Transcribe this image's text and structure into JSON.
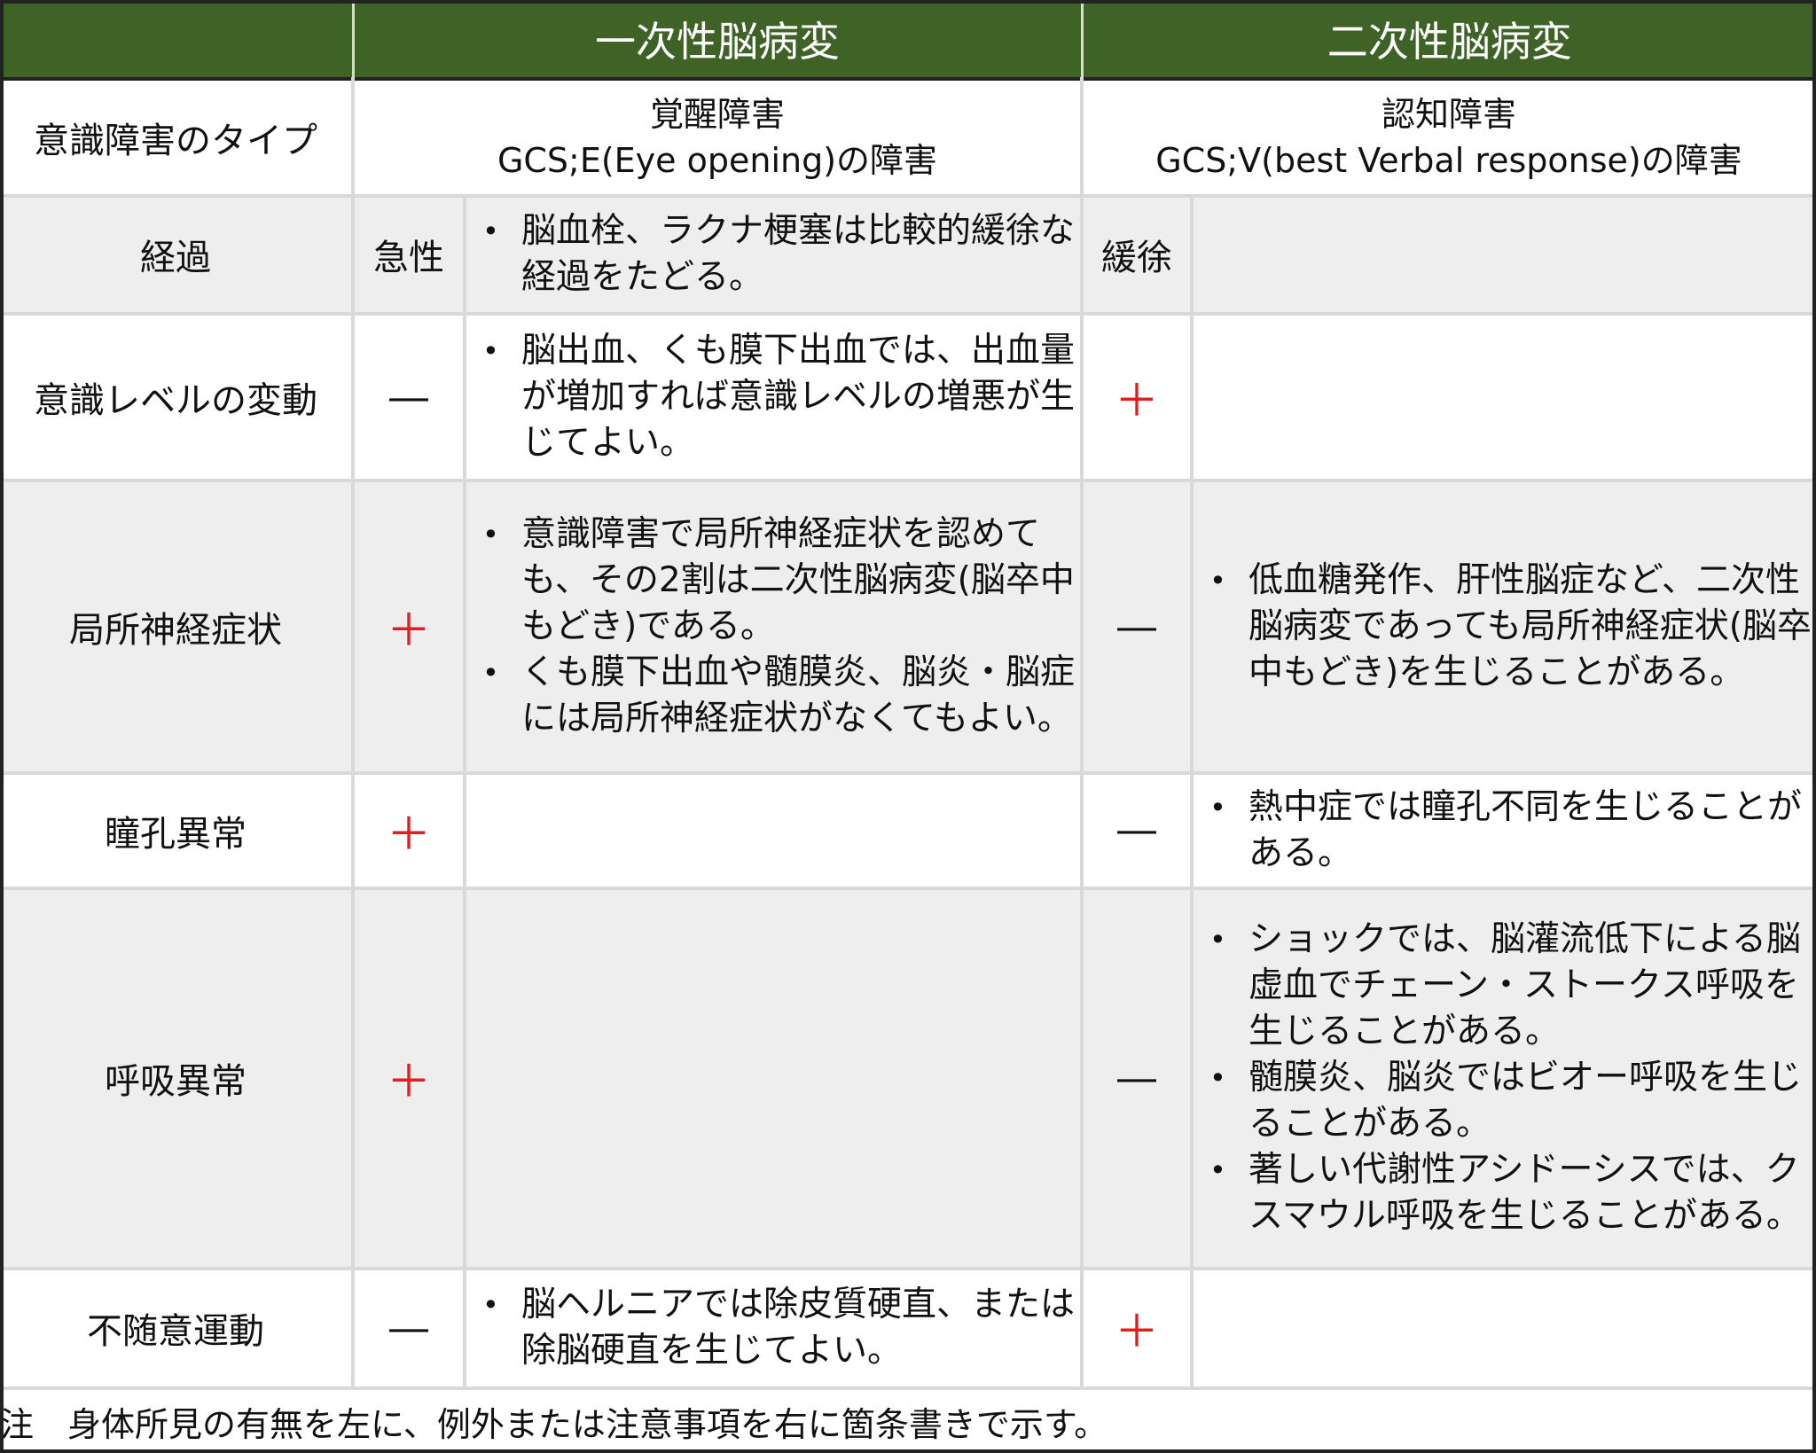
{
  "header": {
    "primary": "一次性脳病変",
    "secondary": "二次性脳病変"
  },
  "rows": {
    "type": {
      "label": "意識障害のタイプ",
      "primary_line1": "覚醒障害",
      "primary_line2": "GCS;E(Eye opening)の障害",
      "secondary_line1": "認知障害",
      "secondary_line2": "GCS;V(best Verbal response)の障害"
    },
    "course": {
      "label": "経過",
      "primary_sign": "急性",
      "primary_notes": [
        "脳血栓、ラクナ梗塞は比較的緩徐な経過をたどる。"
      ],
      "secondary_sign": "緩徐",
      "secondary_notes": []
    },
    "fluctuation": {
      "label": "意識レベルの変動",
      "primary_sign": "―",
      "primary_notes": [
        "脳出血、くも膜下出血では、出血量が増加すれば意識レベルの増悪が生じてよい。"
      ],
      "secondary_sign": "＋",
      "secondary_notes": []
    },
    "focal": {
      "label": "局所神経症状",
      "primary_sign": "＋",
      "primary_notes": [
        "意識障害で局所神経症状を認めても、その2割は二次性脳病変(脳卒中もどき)である。",
        "くも膜下出血や髄膜炎、脳炎・脳症には局所神経症状がなくてもよい。"
      ],
      "secondary_sign": "―",
      "secondary_notes": [
        "低血糖発作、肝性脳症など、二次性脳病変であっても局所神経症状(脳卒中もどき)を生じることがある。"
      ]
    },
    "pupil": {
      "label": "瞳孔異常",
      "primary_sign": "＋",
      "primary_notes": [],
      "secondary_sign": "―",
      "secondary_notes": [
        "熱中症では瞳孔不同を生じることがある。"
      ]
    },
    "respiration": {
      "label": "呼吸異常",
      "primary_sign": "＋",
      "primary_notes": [],
      "secondary_sign": "―",
      "secondary_notes": [
        "ショックでは、脳灌流低下による脳虚血でチェーン・ストークス呼吸を生じることがある。",
        "髄膜炎、脳炎ではビオー呼吸を生じることがある。",
        "著しい代謝性アシドーシスでは、クスマウル呼吸を生じることがある。"
      ]
    },
    "involuntary": {
      "label": "不随意運動",
      "primary_sign": "―",
      "primary_notes": [
        "脳ヘルニアでは除皮質硬直、または除脳硬直を生じてよい。"
      ],
      "secondary_sign": "＋",
      "secondary_notes": []
    }
  },
  "footer": "注　身体所見の有無を左に、例外または注意事項を右に箇条書きで示す。",
  "colors": {
    "header_bg": "#3f6327",
    "plus": "#e02020",
    "row_gray": "#eeeeee"
  }
}
